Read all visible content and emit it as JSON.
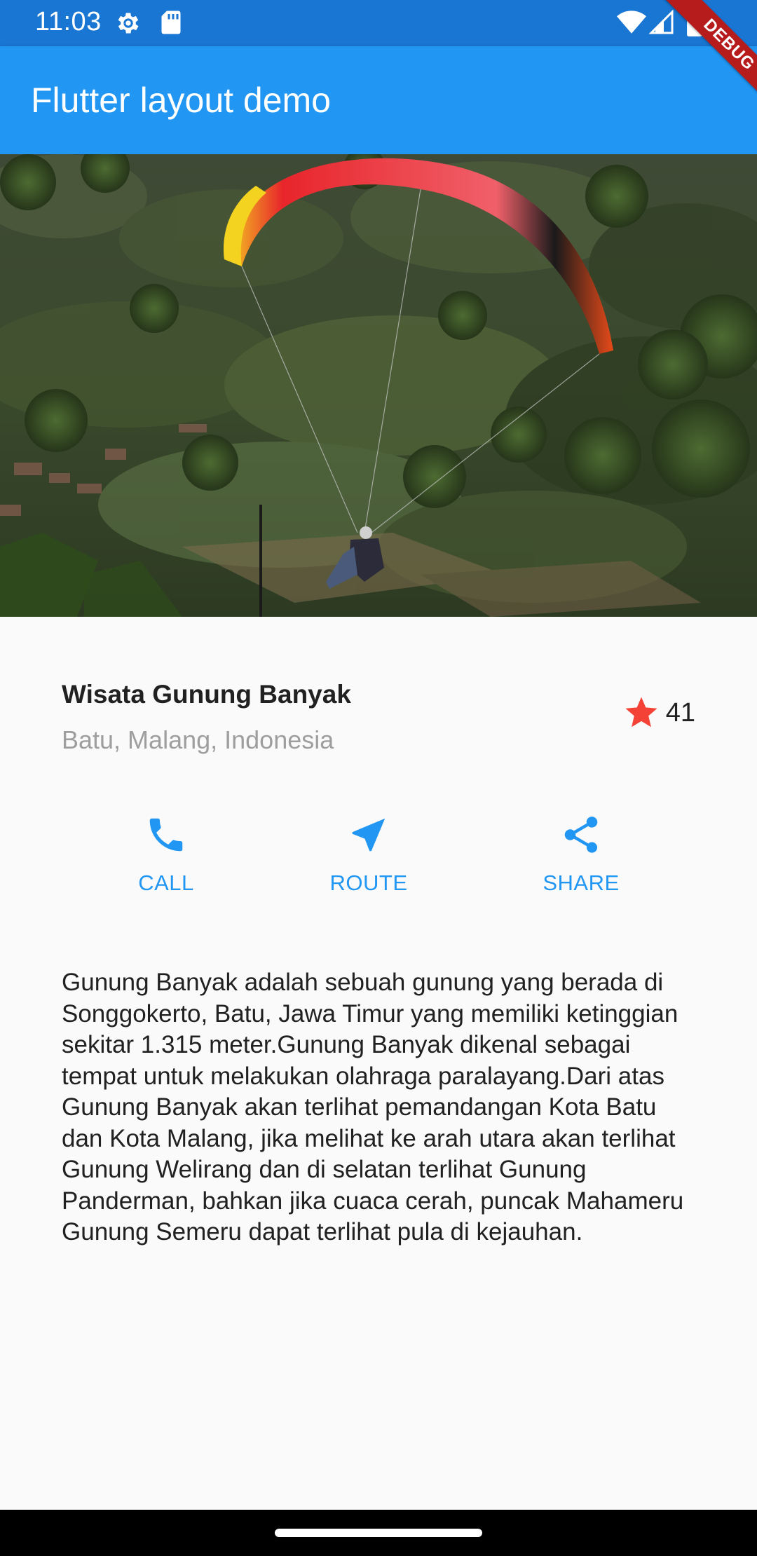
{
  "status": {
    "time": "11:03",
    "icons": [
      "settings-gear-icon",
      "sd-card-icon",
      "wifi-icon",
      "signal-icon",
      "battery-icon"
    ]
  },
  "app_bar": {
    "title": "Flutter layout demo",
    "debug_label": "DEBUG",
    "color": "#2196f3"
  },
  "hero": {
    "image": "paragliding-over-mountain-image"
  },
  "place": {
    "name": "Wisata Gunung Banyak",
    "location": "Batu, Malang, Indonesia",
    "rating_count": "41",
    "rating_icon": "star-icon",
    "rating_color": "#f44336"
  },
  "actions": [
    {
      "label": "CALL",
      "icon": "phone-icon"
    },
    {
      "label": "ROUTE",
      "icon": "navigation-icon"
    },
    {
      "label": "SHARE",
      "icon": "share-icon"
    }
  ],
  "accent_color": "#2196f3",
  "description": "Gunung Banyak adalah sebuah gunung yang berada di Songgokerto, Batu, Jawa Timur yang memiliki ketinggian sekitar 1.315 meter.Gunung Banyak dikenal sebagai tempat untuk melakukan olahraga paralayang.Dari atas Gunung Banyak akan terlihat pemandangan Kota Batu dan Kota Malang, jika melihat ke arah utara akan terlihat Gunung Welirang dan di selatan terlihat Gunung Panderman, bahkan jika cuaca cerah, puncak Mahameru Gunung Semeru dapat terlihat pula di kejauhan."
}
